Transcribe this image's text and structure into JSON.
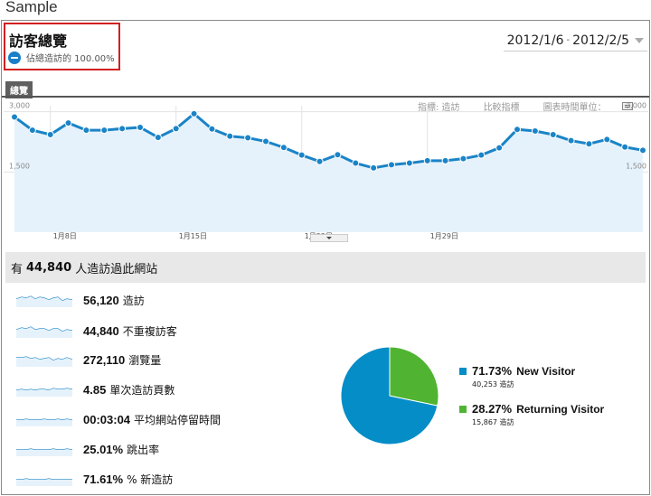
{
  "page": {
    "heading": "Sample"
  },
  "report": {
    "title": "訪客總覽",
    "segment_label": "佔總造訪的 100.00%",
    "tab": "總覽"
  },
  "date_range": {
    "start": "2012/1/6",
    "separator": "-",
    "end": "2012/2/5"
  },
  "chart_controls": {
    "metric": "指標: 造訪",
    "compare": "比較指標",
    "time_unit": "圖表時間單位："
  },
  "chart_data": {
    "type": "area",
    "series": [
      {
        "values": [
          2870,
          2540,
          2430,
          2720,
          2540,
          2540,
          2580,
          2610,
          2360,
          2580,
          2950,
          2570,
          2390,
          2350,
          2260,
          2110,
          1920,
          1760,
          1930,
          1720,
          1600,
          1680,
          1720,
          1780,
          1780,
          1830,
          1920,
          2100,
          2560,
          2520,
          2430,
          2280,
          2200,
          2310,
          2120,
          2040
        ]
      }
    ],
    "ylim": [
      0,
      3150
    ],
    "y_ticks": [
      "3,000",
      "1,500"
    ],
    "y_tick_values": [
      3000,
      1500
    ],
    "x_ticks": [
      "1月8日",
      "1月15日",
      "1月22日",
      "1月29日"
    ],
    "x_tick_indices": [
      2,
      9,
      16,
      23
    ],
    "grid": true,
    "color": "#1a84c7",
    "fill": "#e6f2fb"
  },
  "summary": {
    "prefix": "有",
    "count": "44,840",
    "suffix": "人造訪過此網站"
  },
  "metrics": [
    {
      "value": "56,120",
      "label": "造訪"
    },
    {
      "value": "44,840",
      "label": "不重複訪客"
    },
    {
      "value": "272,110",
      "label": "瀏覽量"
    },
    {
      "value": "4.85",
      "label": "單次造訪頁數"
    },
    {
      "value": "00:03:04",
      "label": "平均網站停留時間"
    },
    {
      "value": "25.01%",
      "label": "跳出率"
    },
    {
      "value": "71.61%",
      "label": "% 新造訪"
    }
  ],
  "pie": {
    "slices": [
      {
        "name": "New Visitor",
        "pct": "71.73%",
        "value": 71.73,
        "count": "40,253 造訪",
        "color": "#058dc7"
      },
      {
        "name": "Returning Visitor",
        "pct": "28.27%",
        "value": 28.27,
        "count": "15,867 造訪",
        "color": "#50b432"
      }
    ]
  }
}
